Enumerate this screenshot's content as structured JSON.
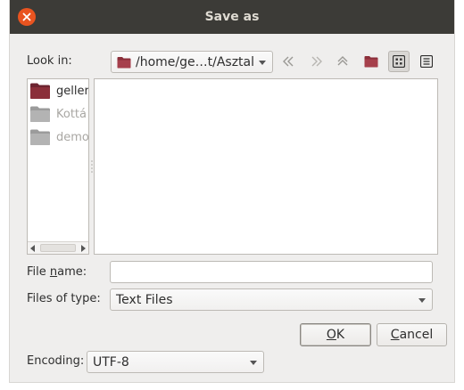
{
  "window": {
    "title": "Save as"
  },
  "look_in": {
    "label": "Look in:",
    "path": "/home/ge…t/Asztal"
  },
  "toolbar_icons": [
    "back-icon",
    "forward-icon",
    "parent-directory-icon",
    "new-folder-icon",
    "icon-view-icon",
    "list-view-icon"
  ],
  "sidebar": {
    "items": [
      {
        "label": "geller",
        "enabled": true
      },
      {
        "label": "Kottá",
        "enabled": false
      },
      {
        "label": "demo",
        "enabled": false
      }
    ]
  },
  "file_name": {
    "label_pre": "File ",
    "label_mnemonic": "n",
    "label_post": "ame:",
    "value": ""
  },
  "file_type": {
    "label": "Files of type:",
    "value": "Text Files"
  },
  "buttons": {
    "ok_mnemonic": "O",
    "ok_rest": "K",
    "cancel_mnemonic": "C",
    "cancel_rest": "ancel"
  },
  "encoding": {
    "label": "Encoding:",
    "value": "UTF-8"
  },
  "colors": {
    "titlebar": "#3c3b37",
    "close": "#e95420",
    "folder_home": "#8b2f3a",
    "folder_grey": "#8a8a8a"
  }
}
